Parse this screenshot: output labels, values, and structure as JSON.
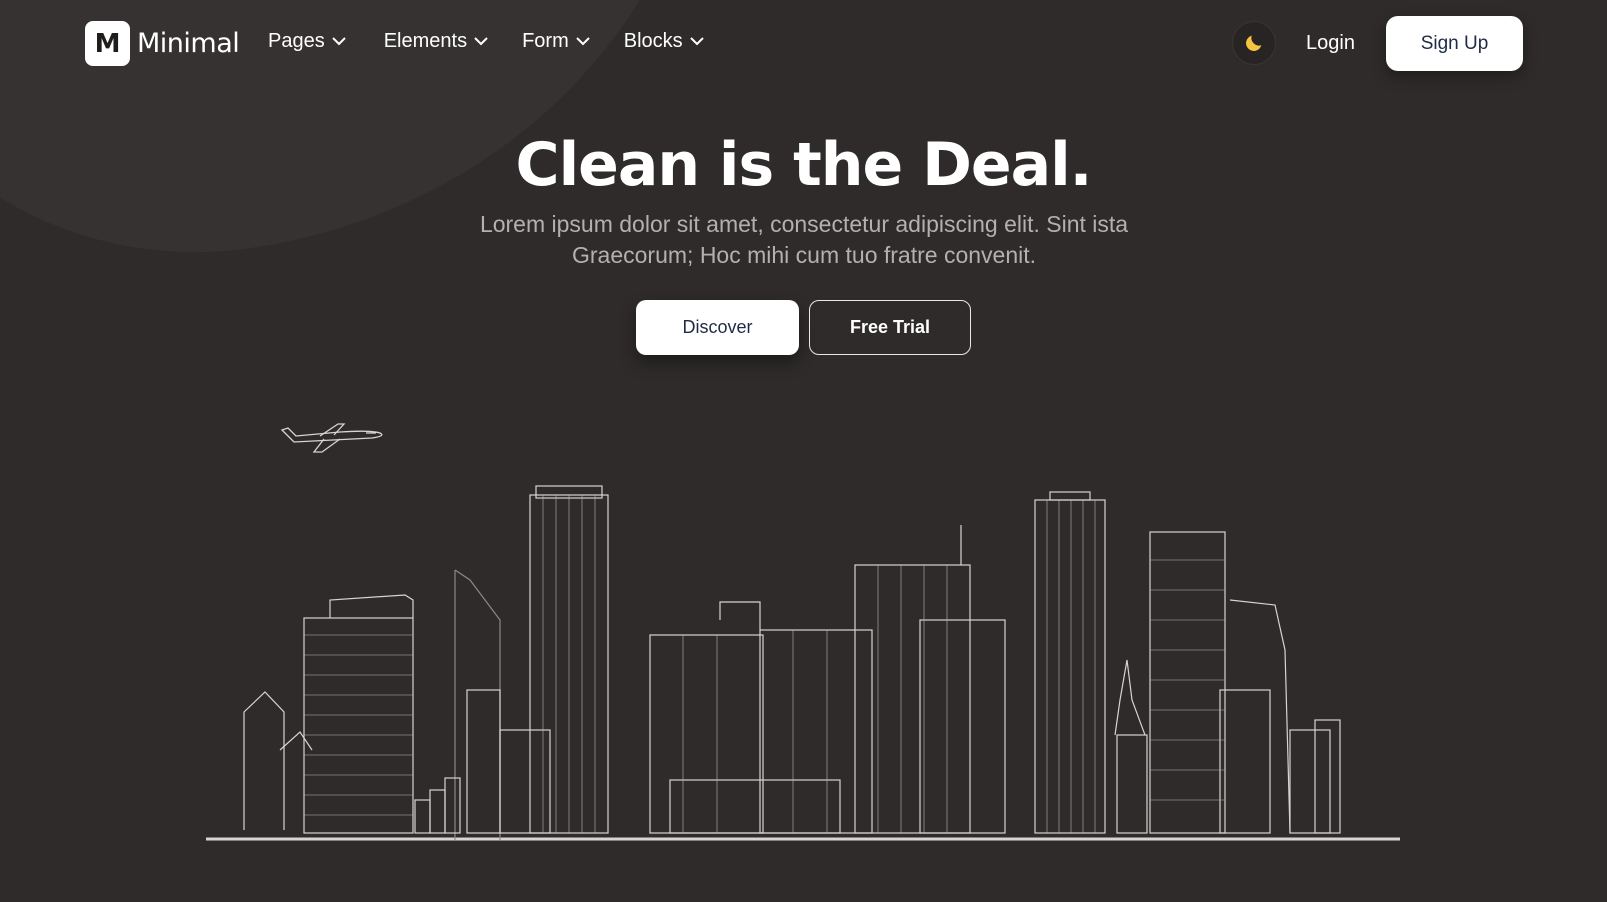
{
  "brand": {
    "name": "Minimal",
    "mark": "M"
  },
  "nav": {
    "items": [
      {
        "label": "Pages",
        "icon": "chevron-down-icon"
      },
      {
        "label": "Elements",
        "icon": "chevron-down-icon"
      },
      {
        "label": "Form",
        "icon": "chevron-down-icon"
      },
      {
        "label": "Blocks",
        "icon": "chevron-down-icon"
      }
    ],
    "theme_icon": "moon-icon",
    "login": "Login",
    "signup": "Sign Up"
  },
  "hero": {
    "title": "Clean is the Deal.",
    "subtitle": "Lorem ipsum dolor sit amet, consectetur adipiscing elit. Sint ista Graecorum; Hoc mihi cum tuo fratre convenit.",
    "primary_button": "Discover",
    "secondary_button": "Free Trial",
    "illustration": "city-skyline-illustration"
  },
  "colors": {
    "background": "#2f2b2b",
    "accent_moon": "#f5c542",
    "button_text": "#1f2b45"
  }
}
